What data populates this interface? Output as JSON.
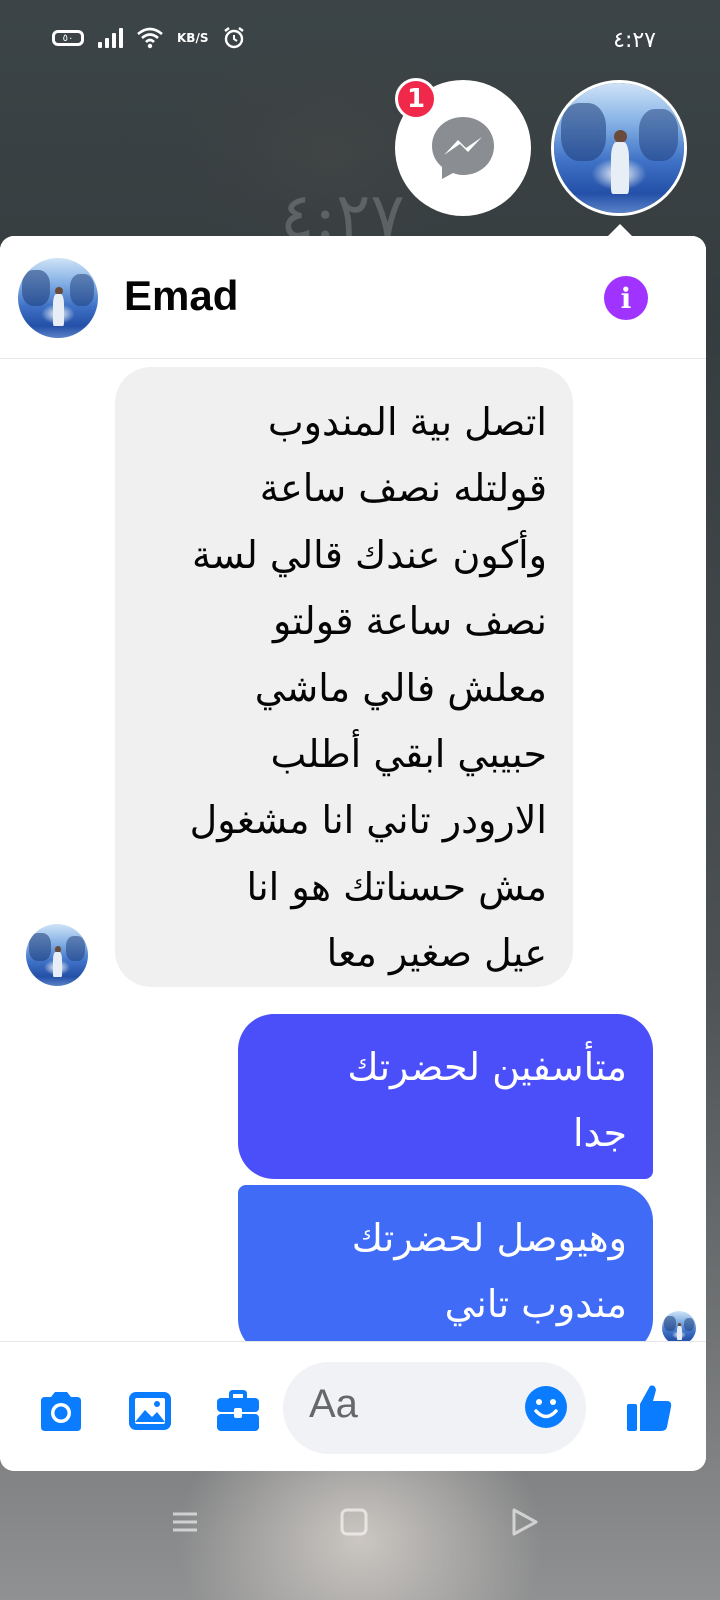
{
  "status_bar": {
    "battery": "٥٠",
    "net_speed": "KB/S",
    "time": "٤:٢٧"
  },
  "wallpaper": {
    "clock_ghost": "٤:٢٧"
  },
  "chat_heads": {
    "badge_count": "1"
  },
  "chat": {
    "contact_name": "Emad",
    "incoming": [
      {
        "lines": [
          "اتصل بية المندوب",
          "قولتله نصف ساعة",
          "وأكون عندك قالي لسة",
          "نصف ساعة قولتو",
          "معلش  فالي ماشي",
          "حبيبي ابقي أطلب",
          "الارودر تاني انا مشغول",
          "مش حسناتك هو انا",
          "عيل صغير معا"
        ]
      }
    ],
    "outgoing": [
      {
        "lines": [
          "متأسفين لحضرتك",
          "جدا"
        ]
      },
      {
        "lines": [
          "وهيوصل لحضرتك",
          "مندوب تاني"
        ]
      }
    ]
  },
  "composer": {
    "placeholder": "Aa",
    "icons": [
      "camera-icon",
      "image-icon",
      "briefcase-icon",
      "emoji-icon",
      "thumbs-up-icon"
    ]
  },
  "colors": {
    "accent": "#0a7cff",
    "info": "#a033ff",
    "bubble_out_1": "#4b4ffa",
    "bubble_out_2": "#3f6bf6",
    "bubble_in": "#f0f0f0",
    "badge": "#f0284a"
  }
}
